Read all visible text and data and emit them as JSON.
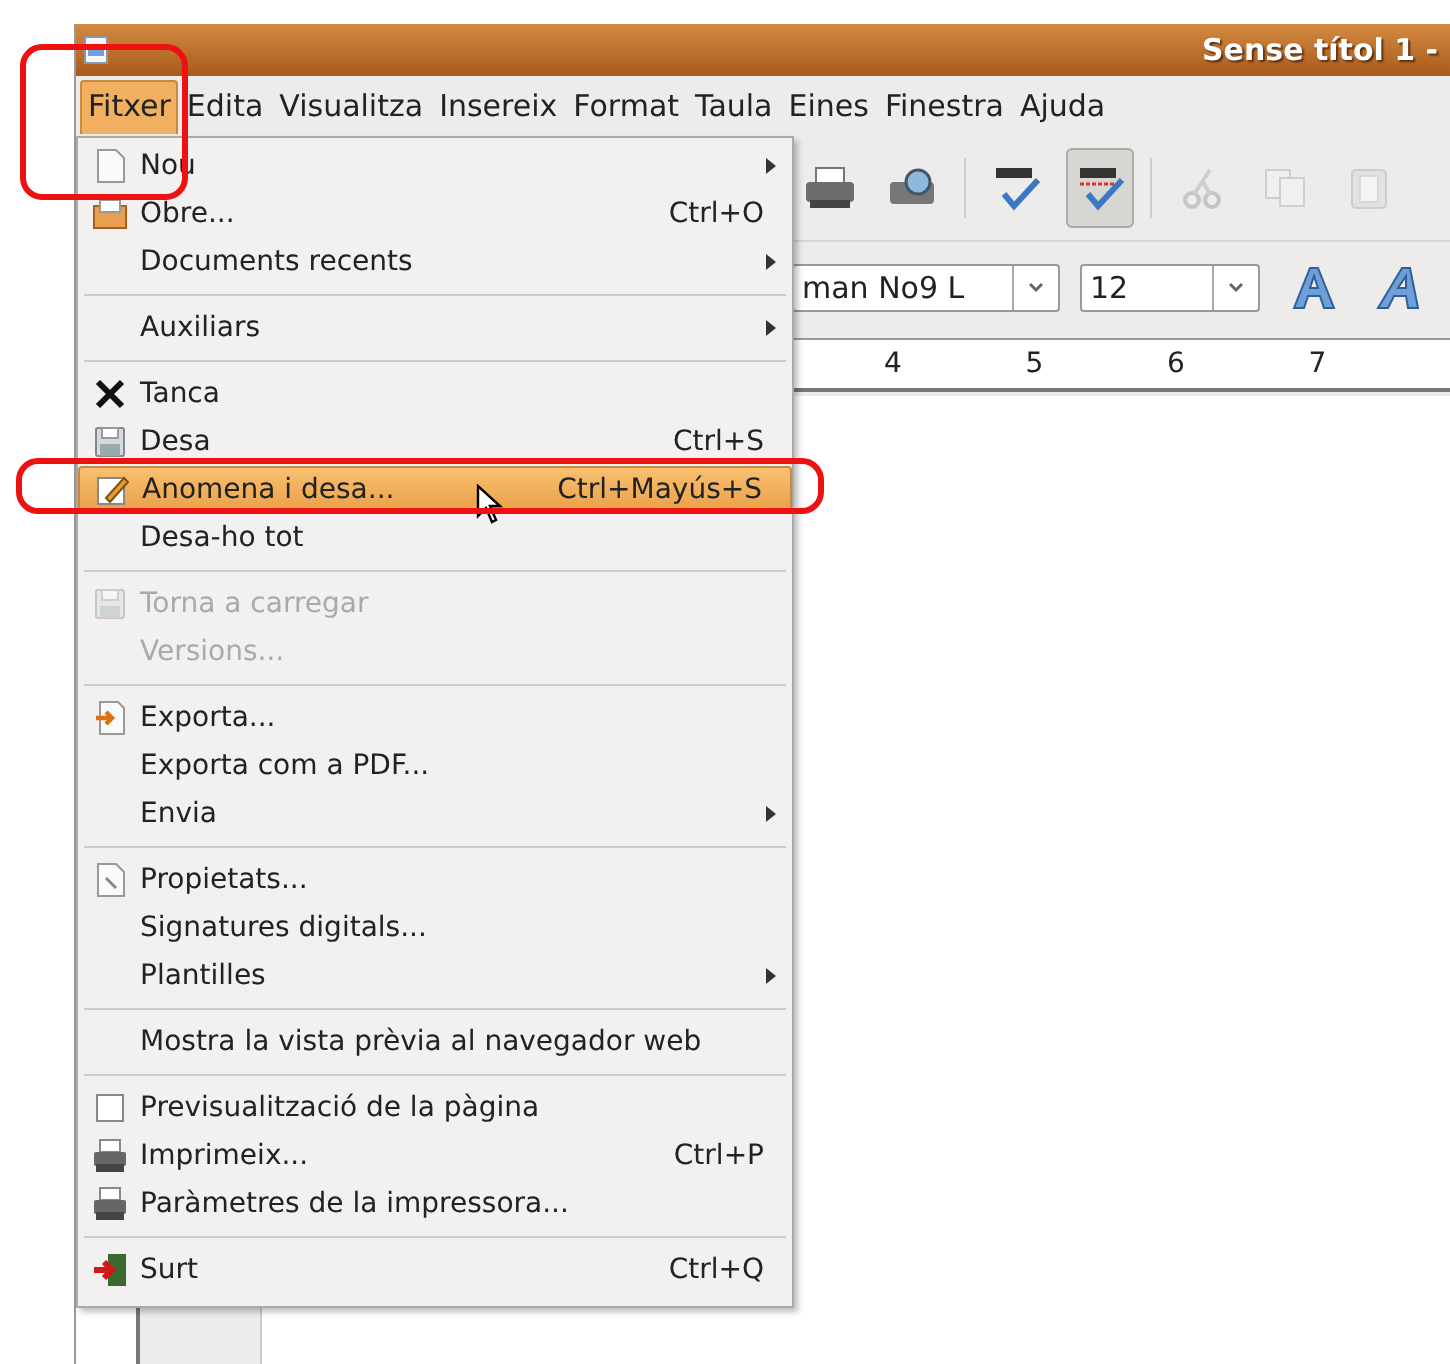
{
  "window": {
    "title": "Sense títol 1 -"
  },
  "menubar": [
    {
      "label": "Fitxer",
      "selected": true
    },
    {
      "label": "Edita",
      "selected": false
    },
    {
      "label": "Visualitza",
      "selected": false
    },
    {
      "label": "Insereix",
      "selected": false
    },
    {
      "label": "Format",
      "selected": false
    },
    {
      "label": "Taula",
      "selected": false
    },
    {
      "label": "Eines",
      "selected": false
    },
    {
      "label": "Finestra",
      "selected": false
    },
    {
      "label": "Ajuda",
      "selected": false
    }
  ],
  "toolbar": [
    {
      "pressed": false,
      "disabled": false
    },
    {
      "pressed": false,
      "disabled": false
    },
    {
      "pressed": false,
      "disabled": false
    },
    {
      "pressed": true,
      "disabled": false
    },
    {
      "pressed": false,
      "disabled": true
    },
    {
      "pressed": false,
      "disabled": true
    },
    {
      "pressed": false,
      "disabled": true
    }
  ],
  "formatting": {
    "font": "man No9 L",
    "size": "12"
  },
  "ruler": [
    "4",
    "5",
    "6",
    "7"
  ],
  "menu": [
    {
      "kind": "item",
      "label": "Nou",
      "submenu": true,
      "selected": false,
      "disabled": false
    },
    {
      "kind": "item",
      "label": "Obre...",
      "shortcut": "Ctrl+O",
      "submenu": false,
      "selected": false,
      "disabled": false
    },
    {
      "kind": "item",
      "label": "Documents recents",
      "submenu": true,
      "selected": false,
      "disabled": false
    },
    {
      "kind": "separator"
    },
    {
      "kind": "item",
      "label": "Auxiliars",
      "submenu": true,
      "selected": false,
      "disabled": false
    },
    {
      "kind": "separator"
    },
    {
      "kind": "item",
      "label": "Tanca",
      "submenu": false,
      "selected": false,
      "disabled": false
    },
    {
      "kind": "item",
      "label": "Desa",
      "shortcut": "Ctrl+S",
      "submenu": false,
      "selected": false,
      "disabled": false
    },
    {
      "kind": "item",
      "label": "Anomena i desa...",
      "shortcut": "Ctrl+Mayús+S",
      "submenu": false,
      "selected": true,
      "disabled": false
    },
    {
      "kind": "item",
      "label": "Desa-ho tot",
      "submenu": false,
      "selected": false,
      "disabled": false
    },
    {
      "kind": "separator"
    },
    {
      "kind": "item",
      "label": "Torna a carregar",
      "submenu": false,
      "selected": false,
      "disabled": true
    },
    {
      "kind": "item",
      "label": "Versions...",
      "submenu": false,
      "selected": false,
      "disabled": true
    },
    {
      "kind": "separator"
    },
    {
      "kind": "item",
      "label": "Exporta...",
      "submenu": false,
      "selected": false,
      "disabled": false
    },
    {
      "kind": "item",
      "label": "Exporta com a PDF...",
      "submenu": false,
      "selected": false,
      "disabled": false
    },
    {
      "kind": "item",
      "label": "Envia",
      "submenu": true,
      "selected": false,
      "disabled": false
    },
    {
      "kind": "separator"
    },
    {
      "kind": "item",
      "label": "Propietats...",
      "submenu": false,
      "selected": false,
      "disabled": false
    },
    {
      "kind": "item",
      "label": "Signatures digitals...",
      "submenu": false,
      "selected": false,
      "disabled": false
    },
    {
      "kind": "item",
      "label": "Plantilles",
      "submenu": true,
      "selected": false,
      "disabled": false
    },
    {
      "kind": "separator"
    },
    {
      "kind": "item",
      "label": "Mostra la vista prèvia al navegador web",
      "submenu": false,
      "selected": false,
      "disabled": false
    },
    {
      "kind": "separator"
    },
    {
      "kind": "check",
      "label": "Previsualització de la pàgina",
      "checked": false,
      "submenu": false,
      "selected": false,
      "disabled": false
    },
    {
      "kind": "item",
      "label": "Imprimeix...",
      "shortcut": "Ctrl+P",
      "submenu": false,
      "selected": false,
      "disabled": false
    },
    {
      "kind": "item",
      "label": "Paràmetres de la impressora...",
      "submenu": false,
      "selected": false,
      "disabled": false
    },
    {
      "kind": "separator"
    },
    {
      "kind": "item",
      "label": "Surt",
      "shortcut": "Ctrl+Q",
      "submenu": false,
      "selected": false,
      "disabled": false
    }
  ]
}
